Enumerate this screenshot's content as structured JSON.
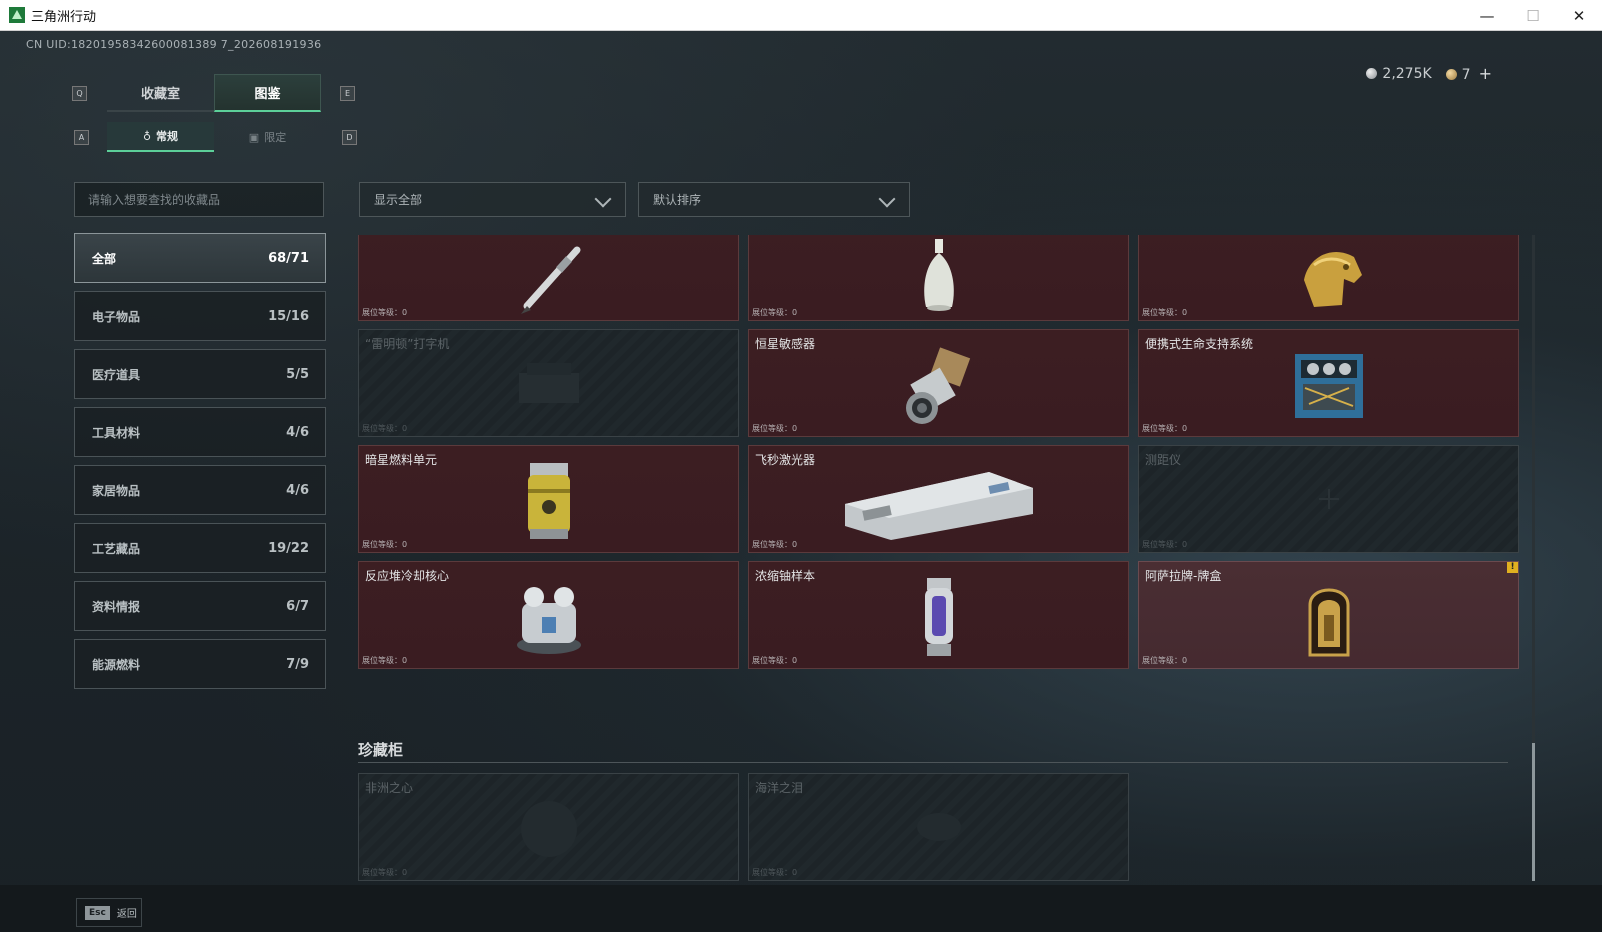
{
  "window": {
    "title": "三角洲行动",
    "minimize": "—",
    "maximize": "☐",
    "close": "✕"
  },
  "uid": "CN UID:18201958342600081389 7_202608191936",
  "currency": {
    "silver_value": "2,275K",
    "gold_value": "7",
    "add_label": "+"
  },
  "keys": {
    "prev_tab": "Q",
    "next_tab": "E",
    "prev_sub": "A",
    "next_sub": "D"
  },
  "tabs": [
    {
      "label": "收藏室"
    },
    {
      "label": "图鉴"
    }
  ],
  "subtabs": [
    {
      "label": "常规"
    },
    {
      "label": "限定"
    }
  ],
  "search": {
    "placeholder": "请输入想要查找的收藏品"
  },
  "filters": {
    "display": "显示全部",
    "sort": "默认排序"
  },
  "categories": [
    {
      "label": "全部",
      "count": "68/71"
    },
    {
      "label": "电子物品",
      "count": "15/16"
    },
    {
      "label": "医疗道具",
      "count": "5/5"
    },
    {
      "label": "工具材料",
      "count": "4/6"
    },
    {
      "label": "家居物品",
      "count": "4/6"
    },
    {
      "label": "工艺藏品",
      "count": "19/22"
    },
    {
      "label": "资料情报",
      "count": "6/7"
    },
    {
      "label": "能源燃料",
      "count": "7/9"
    }
  ],
  "level_label": "展位等级：0",
  "items": [
    {
      "name": "",
      "icon": "pen-icon",
      "locked": false
    },
    {
      "name": "",
      "icon": "vase-icon",
      "locked": false
    },
    {
      "name": "",
      "icon": "golden-horse-head-icon",
      "locked": false
    },
    {
      "name": "“雷明顿”打字机",
      "icon": "typewriter-icon",
      "locked": true
    },
    {
      "name": "恒星敏感器",
      "icon": "sensor-icon",
      "locked": false
    },
    {
      "name": "便携式生命支持系统",
      "icon": "life-support-icon",
      "locked": false
    },
    {
      "name": "暗星燃料单元",
      "icon": "fuel-cell-icon",
      "locked": false
    },
    {
      "name": "飞秒激光器",
      "icon": "laser-icon",
      "locked": false
    },
    {
      "name": "测距仪",
      "icon": "rangefinder-icon",
      "locked": true
    },
    {
      "name": "反应堆冷却核心",
      "icon": "reactor-core-icon",
      "locked": false
    },
    {
      "name": "浓缩铀样本",
      "icon": "uranium-sample-icon",
      "locked": false
    },
    {
      "name": "阿萨拉牌-牌盒",
      "icon": "card-box-icon",
      "locked": false,
      "warning": "!"
    }
  ],
  "showcase": {
    "title": "珍藏柜",
    "items": [
      {
        "name": "非洲之心",
        "icon": "diamond-icon",
        "locked": true
      },
      {
        "name": "海洋之泪",
        "icon": "gem-icon",
        "locked": true
      }
    ]
  },
  "footer": {
    "esc_key": "Esc",
    "back_label": "返回"
  },
  "colors": {
    "accent": "#5ccf99",
    "card_unlocked": "#3c1e22",
    "warning": "#e0b020"
  }
}
